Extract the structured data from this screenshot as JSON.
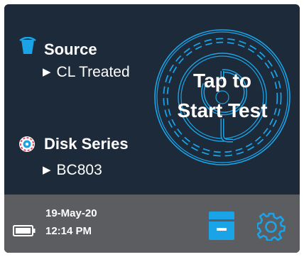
{
  "source": {
    "label": "Source",
    "value": "CL Treated"
  },
  "disk_series": {
    "label": "Disk Series",
    "value": "BC803"
  },
  "start_test": {
    "line1": "Tap to",
    "line2": "Start Test"
  },
  "status": {
    "date": "19-May-20",
    "time": "12:14 PM"
  },
  "icons": {
    "source": "water-cup-icon",
    "disk": "disk-icon",
    "battery": "battery-icon",
    "archive": "archive-icon",
    "settings": "gear-icon",
    "bullet": "triangle-bullet-icon"
  },
  "colors": {
    "background": "#1d2a3a",
    "footer": "#5b5d60",
    "accent": "#1ba3e8",
    "text": "#ffffff"
  }
}
